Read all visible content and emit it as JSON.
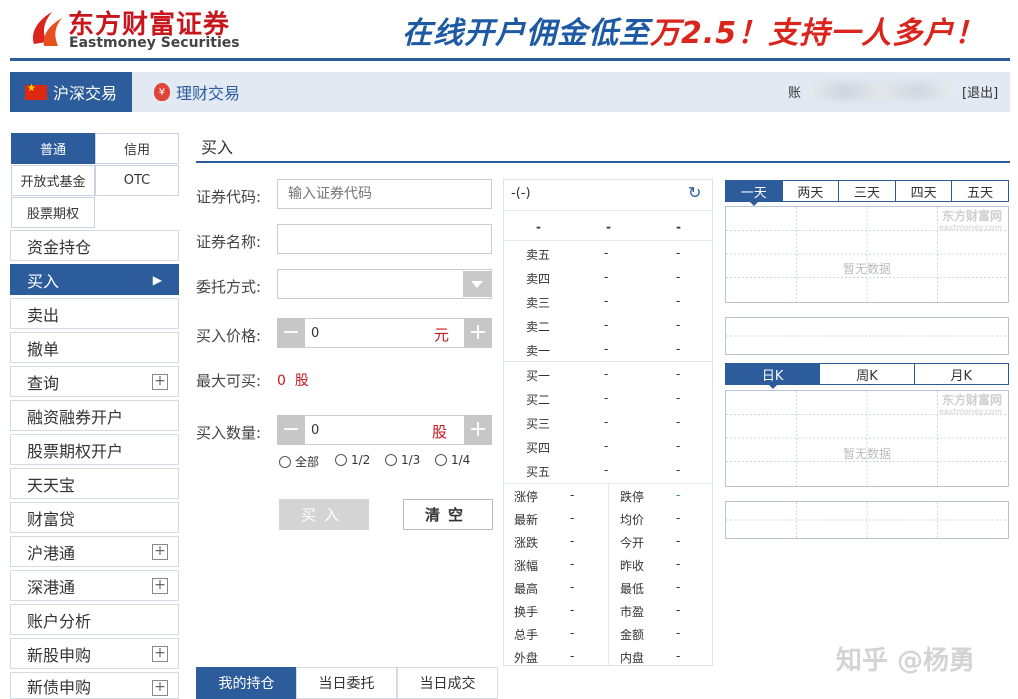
{
  "header": {
    "logo_cn": "东方财富证券",
    "logo_en": "Eastmoney Securities",
    "slogan_part1": "在线开户佣金低至",
    "slogan_part2": "万2.5！支持一人多户！"
  },
  "nav": {
    "tab_sz": "沪深交易",
    "tab_lc": "理财交易",
    "account_prefix": "账",
    "logout": "[退出]"
  },
  "left_menu": {
    "type_tabs": [
      "普通",
      "信用",
      "开放式基金",
      "OTC",
      "股票期权"
    ],
    "items": [
      {
        "label": "资金持仓"
      },
      {
        "label": "买入"
      },
      {
        "label": "卖出"
      },
      {
        "label": "撤单"
      },
      {
        "label": "查询"
      },
      {
        "label": "融资融券开户"
      },
      {
        "label": "股票期权开户"
      },
      {
        "label": "天天宝"
      },
      {
        "label": "财富贷"
      },
      {
        "label": "沪港通"
      },
      {
        "label": "深港通"
      },
      {
        "label": "账户分析"
      },
      {
        "label": "新股申购"
      },
      {
        "label": "新债申购"
      }
    ]
  },
  "form": {
    "title": "买入",
    "code_label": "证券代码:",
    "code_placeholder": "输入证券代码",
    "name_label": "证券名称:",
    "method_label": "委托方式:",
    "price_label": "买入价格:",
    "price_value": "0",
    "price_unit": "元",
    "max_label": "最大可买:",
    "max_value": "0",
    "max_unit": "股",
    "qty_label": "买入数量:",
    "qty_value": "0",
    "qty_unit": "股",
    "ratios": [
      "全部",
      "1/2",
      "1/3",
      "1/4"
    ],
    "buy_button": "买入",
    "clear_button": "清空"
  },
  "bottom_tabs": [
    "我的持仓",
    "当日委托",
    "当日成交"
  ],
  "quote": {
    "title": "-(-)",
    "header": [
      "-",
      "-",
      "-"
    ],
    "sell": [
      {
        "label": "卖五",
        "price": "-",
        "vol": "-"
      },
      {
        "label": "卖四",
        "price": "-",
        "vol": "-"
      },
      {
        "label": "卖三",
        "price": "-",
        "vol": "-"
      },
      {
        "label": "卖二",
        "price": "-",
        "vol": "-"
      },
      {
        "label": "卖一",
        "price": "-",
        "vol": "-"
      }
    ],
    "buy": [
      {
        "label": "买一",
        "price": "-",
        "vol": "-"
      },
      {
        "label": "买二",
        "price": "-",
        "vol": "-"
      },
      {
        "label": "买三",
        "price": "-",
        "vol": "-"
      },
      {
        "label": "买四",
        "price": "-",
        "vol": "-"
      },
      {
        "label": "买五",
        "price": "-",
        "vol": "-"
      }
    ],
    "stats": [
      {
        "l1": "涨停",
        "v1": "-",
        "l2": "跌停",
        "v2": "-"
      },
      {
        "l1": "最新",
        "v1": "-",
        "l2": "均价",
        "v2": "-"
      },
      {
        "l1": "涨跌",
        "v1": "-",
        "l2": "今开",
        "v2": "-"
      },
      {
        "l1": "涨幅",
        "v1": "-",
        "l2": "昨收",
        "v2": "-"
      },
      {
        "l1": "最高",
        "v1": "-",
        "l2": "最低",
        "v2": "-"
      },
      {
        "l1": "换手",
        "v1": "-",
        "l2": "市盈",
        "v2": "-"
      },
      {
        "l1": "总手",
        "v1": "-",
        "l2": "金额",
        "v2": "-"
      },
      {
        "l1": "外盘",
        "v1": "-",
        "l2": "内盘",
        "v2": "-"
      }
    ],
    "colors": {
      "limit_down": "#2a9a2a"
    }
  },
  "charts": {
    "day_tabs": [
      "一天",
      "两天",
      "三天",
      "四天",
      "五天"
    ],
    "k_tabs": [
      "日K",
      "周K",
      "月K"
    ],
    "no_data": "暂无数据",
    "watermark": "东方财富网",
    "watermark_sub": "eastmoney.com"
  },
  "overlay": {
    "zhihu": "知乎 @杨勇"
  },
  "colors": {
    "brand_blue": "#2c5c9b",
    "brand_red": "#c8161d"
  }
}
